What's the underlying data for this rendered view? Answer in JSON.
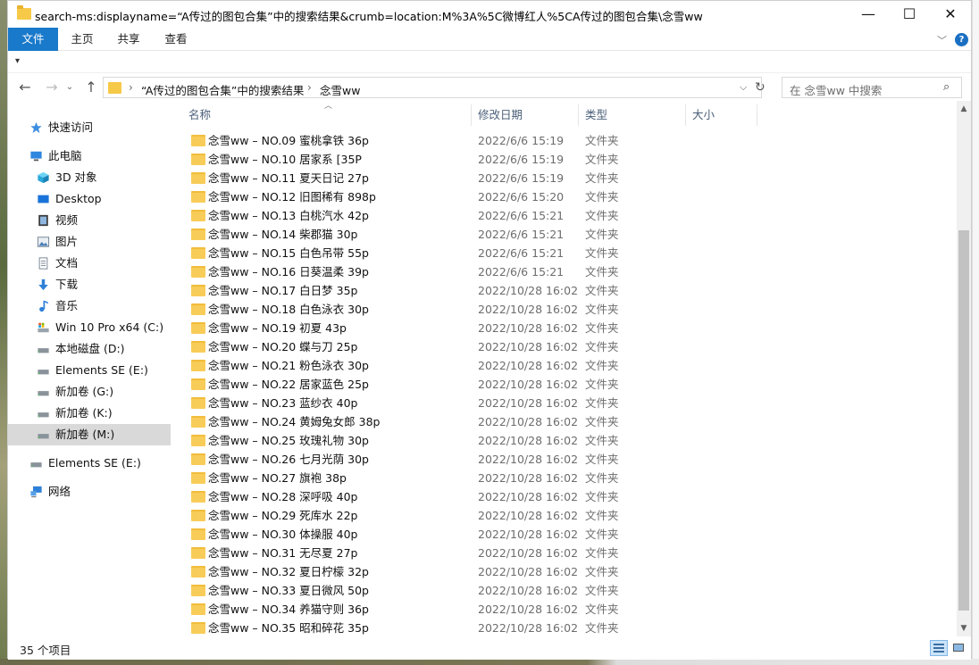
{
  "window": {
    "title": "search-ms:displayname=“A传过的图包合集”中的搜索结果&crumb=location:M%3A%5C微博红人%5CA传过的图包合集\\念雪ww",
    "min_glyph": "—",
    "max_glyph": "☐",
    "close_glyph": "✕"
  },
  "ribbon": {
    "tabs": [
      "文件",
      "主页",
      "共享",
      "查看"
    ],
    "help_glyph": "?"
  },
  "address": {
    "crumbs": [
      "“A传过的图包合集”中的搜索结果",
      "念雪ww"
    ],
    "separator": "›"
  },
  "search": {
    "placeholder": "在 念雪ww 中搜索"
  },
  "sidebar": {
    "items": [
      {
        "label": "快速访问",
        "icon": "star-icon"
      },
      {
        "label": "此电脑",
        "icon": "computer-icon"
      },
      {
        "label": "3D 对象",
        "icon": "cube-icon"
      },
      {
        "label": "Desktop",
        "icon": "desktop-icon"
      },
      {
        "label": "视频",
        "icon": "video-icon"
      },
      {
        "label": "图片",
        "icon": "pictures-icon"
      },
      {
        "label": "文档",
        "icon": "documents-icon"
      },
      {
        "label": "下载",
        "icon": "download-icon"
      },
      {
        "label": "音乐",
        "icon": "music-icon"
      },
      {
        "label": "Win 10 Pro x64 (C:)",
        "icon": "system-drive-icon"
      },
      {
        "label": "本地磁盘 (D:)",
        "icon": "drive-icon"
      },
      {
        "label": "Elements SE (E:)",
        "icon": "drive-icon"
      },
      {
        "label": "新加卷 (G:)",
        "icon": "drive-icon"
      },
      {
        "label": "新加卷 (K:)",
        "icon": "drive-icon"
      },
      {
        "label": "新加卷 (M:)",
        "icon": "drive-icon",
        "selected": true
      },
      {
        "label": "Elements SE (E:)",
        "icon": "drive-icon"
      },
      {
        "label": "网络",
        "icon": "network-icon"
      }
    ]
  },
  "columns": {
    "name": "名称",
    "date": "修改日期",
    "type": "类型",
    "size": "大小"
  },
  "files": [
    {
      "name": "念雪ww – NO.09 蜜桃拿铁 36p",
      "date": "2022/6/6 15:19",
      "type": "文件夹"
    },
    {
      "name": "念雪ww – NO.10 居家系 [35P",
      "date": "2022/6/6 15:19",
      "type": "文件夹"
    },
    {
      "name": "念雪ww – NO.11 夏天日记 27p",
      "date": "2022/6/6 15:19",
      "type": "文件夹"
    },
    {
      "name": "念雪ww – NO.12 旧图稀有 898p",
      "date": "2022/6/6 15:20",
      "type": "文件夹"
    },
    {
      "name": "念雪ww – NO.13 白桃汽水 42p",
      "date": "2022/6/6 15:21",
      "type": "文件夹"
    },
    {
      "name": "念雪ww – NO.14 柴郡猫 30p",
      "date": "2022/6/6 15:21",
      "type": "文件夹"
    },
    {
      "name": "念雪ww – NO.15 白色吊带 55p",
      "date": "2022/6/6 15:21",
      "type": "文件夹"
    },
    {
      "name": "念雪ww – NO.16 日葵温柔 39p",
      "date": "2022/6/6 15:21",
      "type": "文件夹"
    },
    {
      "name": "念雪ww – NO.17 白日梦 35p",
      "date": "2022/10/28 16:02",
      "type": "文件夹"
    },
    {
      "name": "念雪ww – NO.18 白色泳衣 30p",
      "date": "2022/10/28 16:02",
      "type": "文件夹"
    },
    {
      "name": "念雪ww – NO.19 初夏 43p",
      "date": "2022/10/28 16:02",
      "type": "文件夹"
    },
    {
      "name": "念雪ww – NO.20 蝶与刀 25p",
      "date": "2022/10/28 16:02",
      "type": "文件夹"
    },
    {
      "name": "念雪ww – NO.21 粉色泳衣 30p",
      "date": "2022/10/28 16:02",
      "type": "文件夹"
    },
    {
      "name": "念雪ww – NO.22 居家蓝色 25p",
      "date": "2022/10/28 16:02",
      "type": "文件夹"
    },
    {
      "name": "念雪ww – NO.23 蓝纱衣 40p",
      "date": "2022/10/28 16:02",
      "type": "文件夹"
    },
    {
      "name": "念雪ww – NO.24 黄姆兔女郎 38p",
      "date": "2022/10/28 16:02",
      "type": "文件夹"
    },
    {
      "name": "念雪ww – NO.25 玫瑰礼物 30p",
      "date": "2022/10/28 16:02",
      "type": "文件夹"
    },
    {
      "name": "念雪ww – NO.26 七月光荫 30p",
      "date": "2022/10/28 16:02",
      "type": "文件夹"
    },
    {
      "name": "念雪ww – NO.27 旗袍 38p",
      "date": "2022/10/28 16:02",
      "type": "文件夹"
    },
    {
      "name": "念雪ww – NO.28 深呼吸 40p",
      "date": "2022/10/28 16:02",
      "type": "文件夹"
    },
    {
      "name": "念雪ww – NO.29 死库水 22p",
      "date": "2022/10/28 16:02",
      "type": "文件夹"
    },
    {
      "name": "念雪ww – NO.30 体操服 40p",
      "date": "2022/10/28 16:02",
      "type": "文件夹"
    },
    {
      "name": "念雪ww – NO.31 无尽夏 27p",
      "date": "2022/10/28 16:02",
      "type": "文件夹"
    },
    {
      "name": "念雪ww – NO.32 夏日柠檬 32p",
      "date": "2022/10/28 16:02",
      "type": "文件夹"
    },
    {
      "name": "念雪ww – NO.33 夏日微风 50p",
      "date": "2022/10/28 16:02",
      "type": "文件夹"
    },
    {
      "name": "念雪ww – NO.34 养猫守则 36p",
      "date": "2022/10/28 16:02",
      "type": "文件夹"
    },
    {
      "name": "念雪ww – NO.35 昭和碎花 35p",
      "date": "2022/10/28 16:02",
      "type": "文件夹"
    }
  ],
  "status": {
    "item_count": "35 个项目"
  },
  "colors": {
    "accent": "#1979ca",
    "folder": "#f8cc58",
    "selection": "#d9d9d9",
    "header_text": "#4c607a"
  }
}
